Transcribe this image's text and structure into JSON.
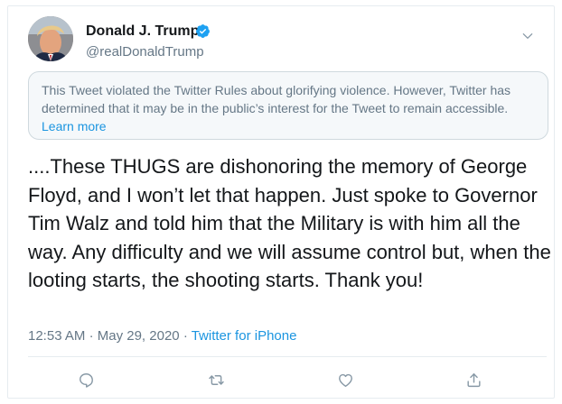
{
  "tweet": {
    "display_name": "Donald J. Trump",
    "handle": "@realDonaldTrump",
    "verified": true,
    "notice_text": "This Tweet violated the Twitter Rules about glorifying violence. However, Twitter has determined that it may be in the public’s interest for the Tweet to remain accessible.",
    "notice_link": "Learn more",
    "text": "....These THUGS are dishonoring the memory of George Floyd, and I won’t let that happen. Just spoke to Governor Tim Walz and told him that the Military is with him all the way. Any difficulty and we will assume control but, when the looting starts, the shooting starts. Thank you!",
    "time": "12:53 AM",
    "date": "May 29, 2020",
    "separator": "·",
    "source": "Twitter for iPhone"
  },
  "icons": {
    "verified": "verified-badge-icon",
    "menu": "chevron-down-icon",
    "reply": "reply-icon",
    "retweet": "retweet-icon",
    "like": "heart-icon",
    "share": "share-icon"
  },
  "colors": {
    "accent": "#1b95e0",
    "secondary_text": "#657786",
    "primary_text": "#14171a",
    "notice_bg": "#f5f8fa",
    "border": "#e6ecf0"
  }
}
